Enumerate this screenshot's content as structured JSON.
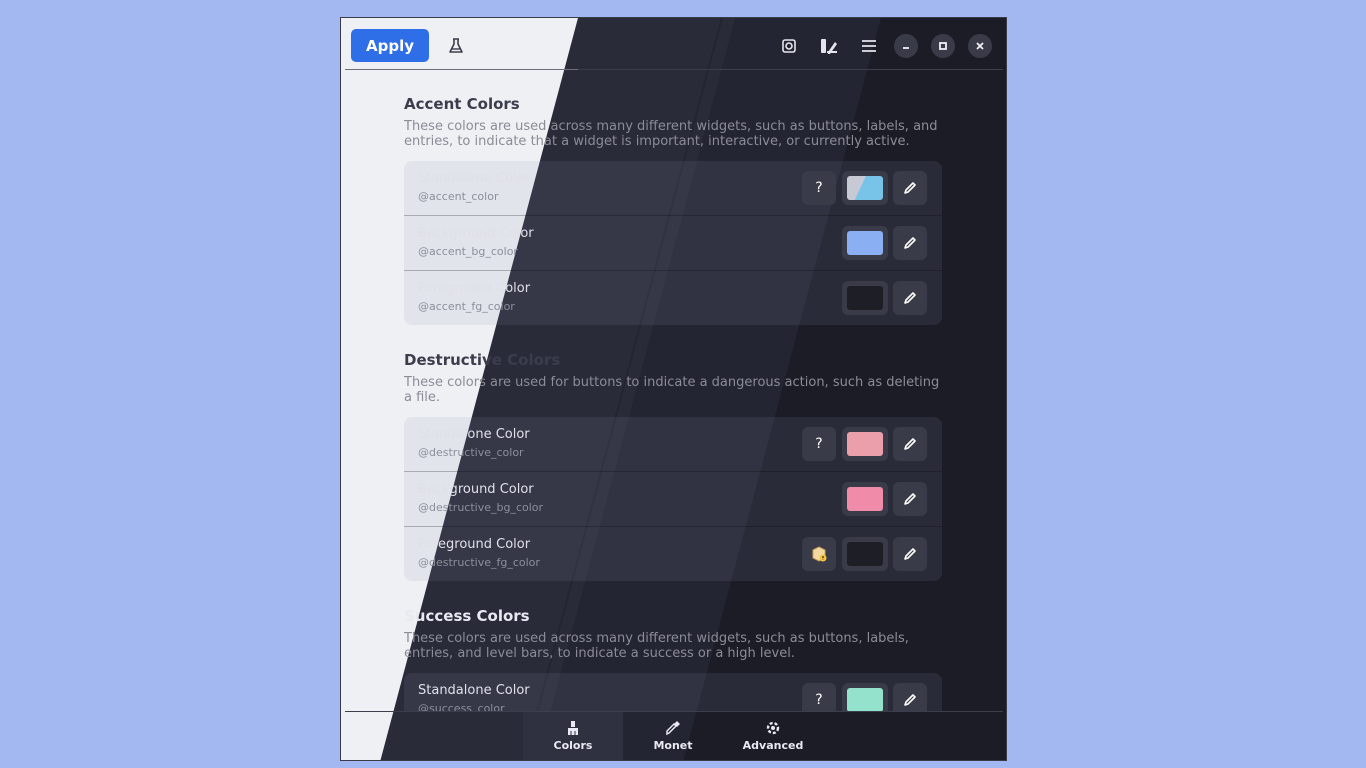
{
  "header": {
    "apply_label": "Apply",
    "icons": [
      "flask-icon",
      "screenshot-icon",
      "palette-edit-icon",
      "menu-icon",
      "minimize-icon",
      "maximize-icon",
      "close-icon"
    ]
  },
  "sections": [
    {
      "title": "Accent Colors",
      "description": "These colors are used across many different widgets, such as buttons, labels, and entries, to indicate that a widget is important, interactive, or currently active.",
      "rows": [
        {
          "title": "Standalone Color",
          "var": "@accent_color",
          "color": "#78c4e8",
          "has_help": true
        },
        {
          "title": "Background Color",
          "var": "@accent_bg_color",
          "color": "#8ab0f3",
          "has_help": false
        },
        {
          "title": "Foreground Color",
          "var": "@accent_fg_color",
          "color": "#1e1e27",
          "has_help": false
        }
      ]
    },
    {
      "title": "Destructive Colors",
      "description": "These colors are used for buttons to indicate a dangerous action, such as deleting a file.",
      "rows": [
        {
          "title": "Standalone Color",
          "var": "@destructive_color",
          "color": "#ea9fab",
          "has_help": true
        },
        {
          "title": "Background Color",
          "var": "@destructive_bg_color",
          "color": "#f08ca9",
          "has_help": false
        },
        {
          "title": "Foreground Color",
          "var": "@destructive_fg_color",
          "color": "#1e1e27",
          "has_help": false,
          "has_warning": true
        }
      ]
    },
    {
      "title": "Success Colors",
      "description": "These colors are used across many different widgets, such as buttons, labels, entries, and level bars, to indicate a success or a high level.",
      "rows": [
        {
          "title": "Standalone Color",
          "var": "@success_color",
          "color": "#94e2cb",
          "has_help": true
        }
      ]
    }
  ],
  "nav": {
    "colors_label": "Colors",
    "monet_label": "Monet",
    "advanced_label": "Advanced"
  }
}
